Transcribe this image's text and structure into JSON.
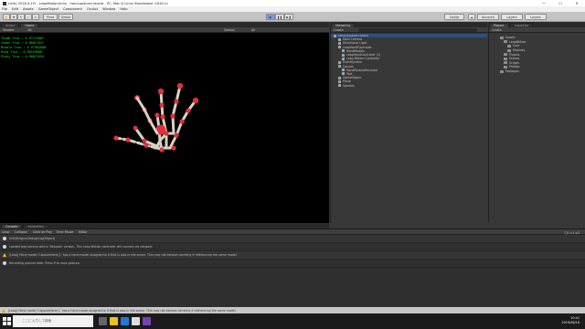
{
  "window": {
    "title": "Unity 2018.4.1f1 - LeapMotionUnity - hand-posture-record - PC, Mac & Linux Standalone <DX11>",
    "minimize": "—",
    "maximize": "☐",
    "close": "✕"
  },
  "menu": [
    "File",
    "Edit",
    "Assets",
    "GameObject",
    "Component",
    "Oculus",
    "Window",
    "Help"
  ],
  "toolbar": {
    "pivot": "Pivot",
    "global": "Global",
    "play_icon": "play-icon",
    "pause_icon": "pause-icon",
    "step_icon": "step-icon",
    "collab": "Collab",
    "account": "Account",
    "layers": "Layers",
    "layout": "Layout"
  },
  "scene_tabs": [
    "Scene",
    "Game"
  ],
  "scene_toolbar": {
    "shaded": "Shaded",
    "dim": "2D",
    "gizmos": "Gizmos",
    "search_all": "All"
  },
  "overlay": [
    "Thumb True : 0.97123007",
    "Index True : 0.98017047",
    "Middle True : 0.97364908",
    "Ring True : 0.95529066",
    "Pinky True : 0.98013454"
  ],
  "hierarchy": {
    "tab": "Hierarchy",
    "create": "Create",
    "items": [
      "hand-posture-record",
      "Main Camera",
      "Directional Light",
      "LeapHandController",
      "HandModels",
      "LeapHandController (1)",
      "Leap Motion Controller",
      "EventSystem",
      "Canvas",
      "HandPostureRecorder",
      "Text",
      "GameObject",
      "Plane",
      "Spheres"
    ]
  },
  "project": {
    "tabs": [
      "Project",
      "Inspector"
    ],
    "create": "Create",
    "items": [
      "Assets",
      "LeapMotion",
      "Core",
      "Modules",
      "Plugins",
      "Scenes",
      "Scripts",
      "Prefabs",
      "Packages"
    ]
  },
  "console": {
    "tabs": [
      "Console",
      "Animation"
    ],
    "clear": "Clear",
    "collapse": "Collapse",
    "clear_on_play": "Clear on Play",
    "error_pause": "Error Pause",
    "editor": "Editor",
    "counts": [
      "0",
      "1",
      "2"
    ],
    "rows": [
      {
        "type": "info",
        "text": "UnityEngine.Debug:Log(Object)"
      },
      {
        "type": "info",
        "text": "Loaded leap service with a 'Network' version. This Leap Motion controller will connect via network."
      },
      {
        "type": "warn",
        "text": "[Leap] Hand model 'CapsuleHand_L' has a hand model assigned to it that is also in the scene. This may not behave correctly if referencing the same model."
      },
      {
        "type": "info",
        "text": "Recording posture data. Press R to save posture."
      }
    ]
  },
  "status": {
    "text": "[Leap] Hand model 'CapsuleHand_L' has a hand model assigned to it that is also in the scene. This may not behave correctly if referencing the same model."
  },
  "taskbar": {
    "search_placeholder": "ここに入力して検索",
    "time": "10:41",
    "date": "2019/06/18"
  },
  "colors": {
    "overlay_text": "#19e52a",
    "warning": "#f2c200",
    "bone": "#d9d2c4",
    "joint": "#e0303b"
  }
}
